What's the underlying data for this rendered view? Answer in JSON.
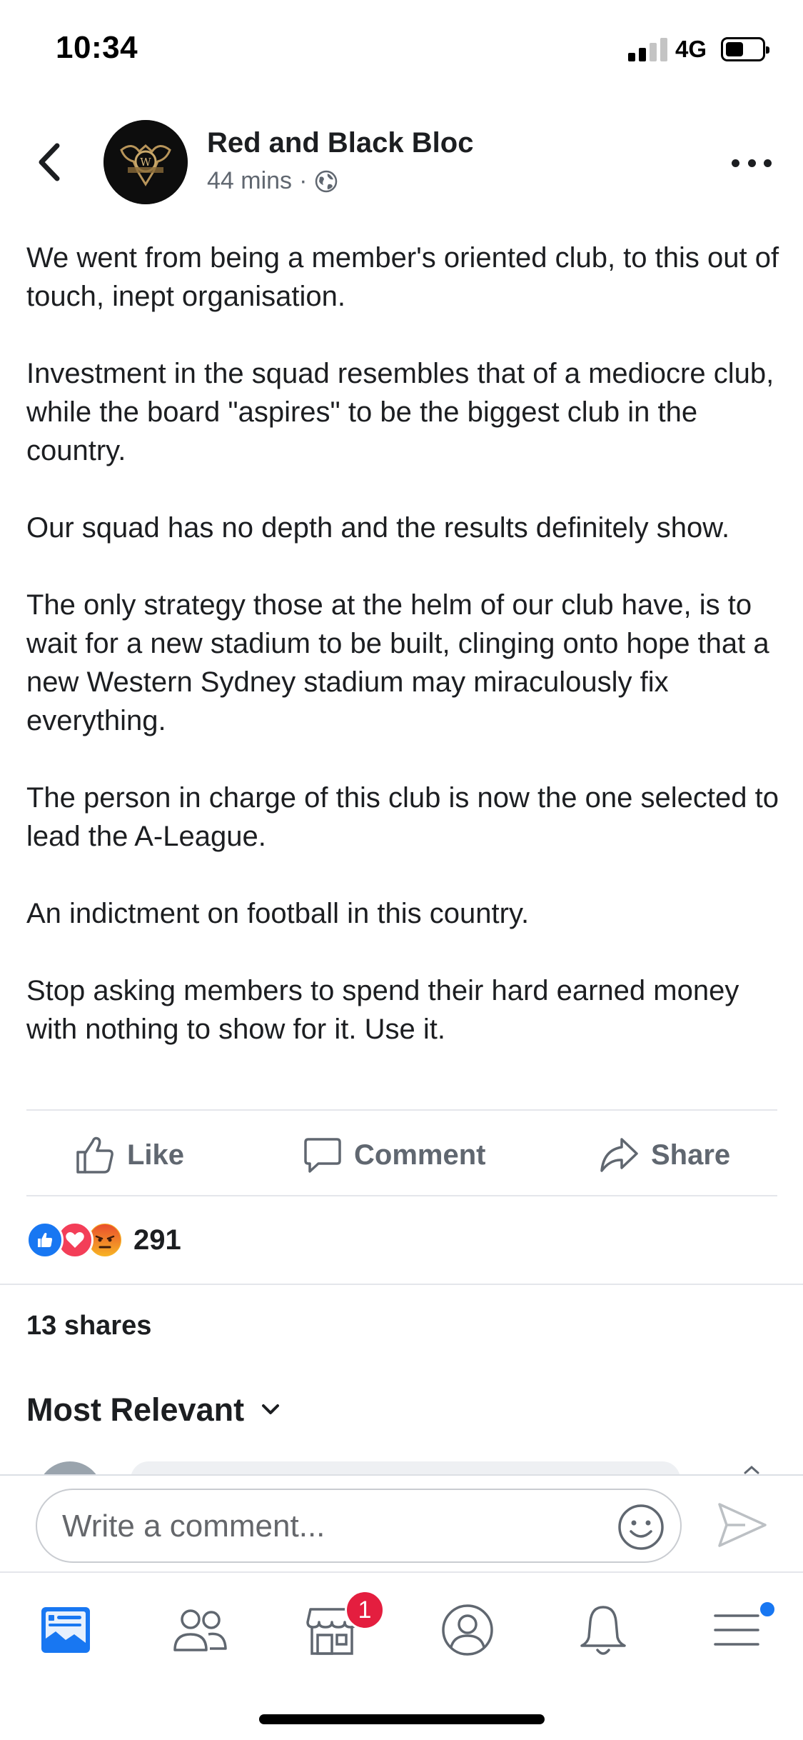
{
  "status_bar": {
    "time": "10:34",
    "network": "4G",
    "signal_bars": 2,
    "signal_bars_total": 4,
    "battery_level": 0.4
  },
  "post": {
    "page_name": "Red and Black Bloc",
    "time_ago": "44 mins",
    "separator": "·",
    "paragraphs": [
      "We went from being a member's oriented club, to this out of touch, inept organisation.",
      "Investment in the squad resembles that of a mediocre club, while the board \"aspires\" to be the biggest club in the country.",
      "Our squad has no depth and the results definitely show.",
      "The only strategy those at the helm of our club have, is to wait for a new stadium to be built, clinging onto hope that a new Western Sydney stadium may miraculously fix everything.",
      "The person in charge of this club is now the one selected to lead the A-League.",
      "An indictment on football in this country.",
      "Stop asking members to spend their hard earned money with nothing to show for it. Use it."
    ]
  },
  "actions": {
    "like": "Like",
    "comment": "Comment",
    "share": "Share"
  },
  "reactions": {
    "count": "291",
    "types": [
      "like-icon",
      "love-icon",
      "angry-icon"
    ]
  },
  "shares": "13 shares",
  "sort": {
    "label": "Most Relevant"
  },
  "composer": {
    "placeholder": "Write a comment..."
  },
  "nav": {
    "items": [
      "news-feed-icon",
      "friends-icon",
      "marketplace-icon",
      "profile-icon",
      "notifications-icon",
      "menu-icon"
    ],
    "marketplace_badge": "1"
  },
  "colors": {
    "accent": "#1877f2",
    "badge": "#e41e3f",
    "text": "#1c1e21",
    "secondary": "#606770",
    "love": "#f33e58",
    "angry": "#f7b125"
  }
}
